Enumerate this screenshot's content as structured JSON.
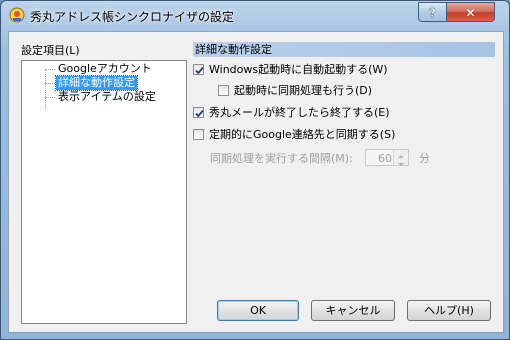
{
  "window": {
    "title": "秀丸アドレス帳シンクロナイザの設定",
    "help_button": "?",
    "close_button": "✕"
  },
  "tree": {
    "label": "設定項目(L)",
    "items": [
      {
        "label": "Googleアカウント",
        "selected": false
      },
      {
        "label": "詳細な動作設定",
        "selected": true
      },
      {
        "label": "表示アイテムの設定",
        "selected": false
      }
    ]
  },
  "group": {
    "header": "詳細な動作設定",
    "options": [
      {
        "label": "Windows起動時に自動起動する(W)",
        "checked": true,
        "enabled": true
      },
      {
        "label": "起動時に同期処理も行う(D)",
        "checked": false,
        "enabled": true
      },
      {
        "label": "秀丸メールが終了したら終了する(E)",
        "checked": true,
        "enabled": true
      },
      {
        "label": "定期的にGoogle連絡先と同期する(S)",
        "checked": false,
        "enabled": true
      }
    ],
    "interval_label": "同期処理を実行する間隔(M):",
    "interval_value": "60",
    "interval_unit": "分"
  },
  "buttons": {
    "ok": "OK",
    "cancel": "キャンセル",
    "help": "ヘルプ(H)"
  },
  "colors": {
    "selection": "#3399ff",
    "header_band": "#b9d0ea",
    "close_button": "#c04025"
  }
}
